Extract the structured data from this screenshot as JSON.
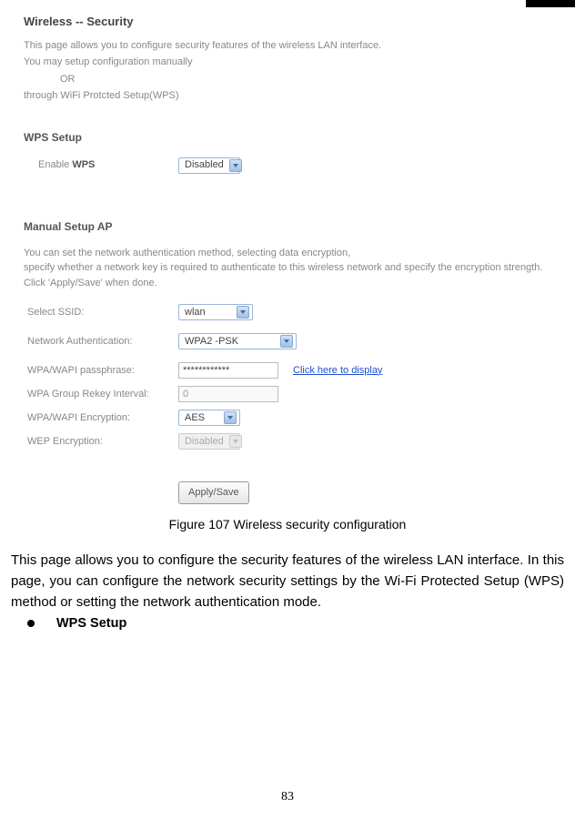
{
  "screenshot": {
    "page_title": "Wireless -- Security",
    "intro_line1": "This page allows you to configure security features of the wireless LAN interface.",
    "intro_line2": "You may setup configuration manually",
    "intro_or": "OR",
    "intro_line3": "through WiFi Protcted Setup(WPS)",
    "wps_section": "WPS Setup",
    "enable_wps_label": "Enable WPS",
    "enable_wps_value": "Disabled",
    "manual_section": "Manual Setup AP",
    "manual_desc1": "You can set the network authentication method, selecting data encryption,",
    "manual_desc2": "specify whether a network key is required to authenticate to this wireless network and specify the encryption strength.",
    "manual_desc3": "Click 'Apply/Save' when done.",
    "fields": {
      "select_ssid_label": "Select SSID:",
      "select_ssid_value": "wlan",
      "net_auth_label": "Network Authentication:",
      "net_auth_value": "WPA2 -PSK",
      "passphrase_label": "WPA/WAPI passphrase:",
      "passphrase_value": "************",
      "passphrase_link": "Click here to display",
      "rekey_label": "WPA Group Rekey Interval:",
      "rekey_value": "0",
      "wpa_enc_label": "WPA/WAPI Encryption:",
      "wpa_enc_value": "AES",
      "wep_enc_label": "WEP Encryption:",
      "wep_enc_value": "Disabled"
    },
    "apply_button": "Apply/Save"
  },
  "caption": "Figure 107 Wireless security configuration",
  "body": "This page allows you to configure the security features of the wireless LAN interface. In this page, you can configure the network security settings by the Wi-Fi Protected Setup (WPS) method or setting the network authentication mode.",
  "bullet": "WPS Setup",
  "page_number": "83"
}
